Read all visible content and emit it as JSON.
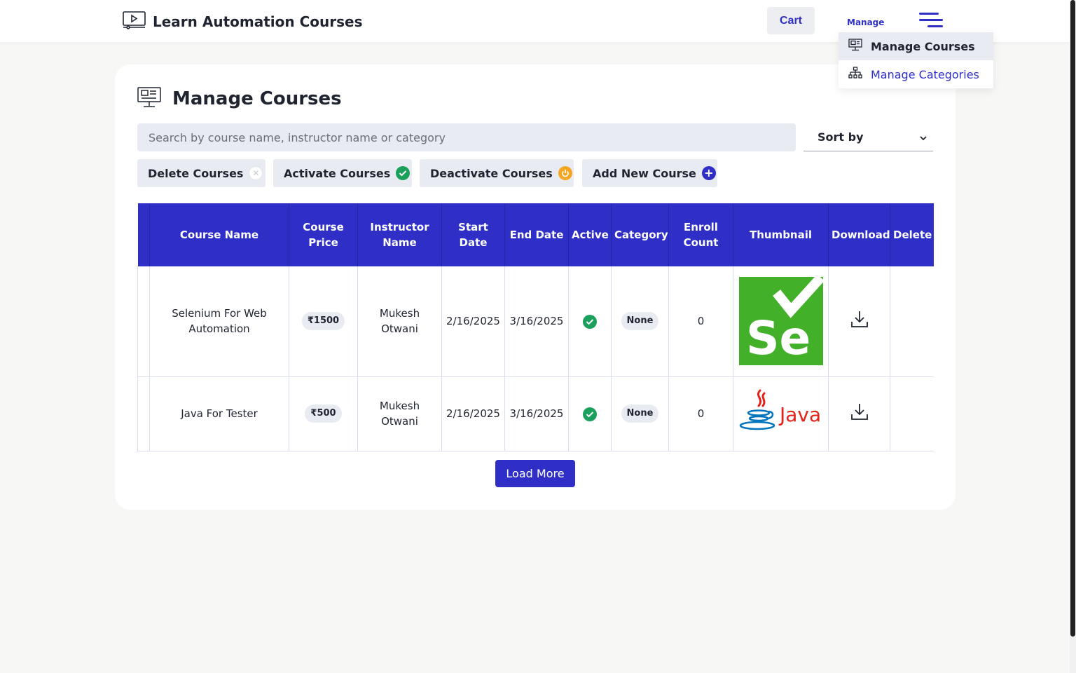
{
  "header": {
    "brand_title": "Learn Automation Courses",
    "cart_label": "Cart",
    "manage_label": "Manage"
  },
  "dropdown": {
    "items": [
      {
        "label": "Manage Courses",
        "icon": "monitor-icon",
        "active": true
      },
      {
        "label": "Manage Categories",
        "icon": "hierarchy-icon",
        "active": false
      }
    ]
  },
  "page": {
    "title": "Manage Courses"
  },
  "search": {
    "placeholder": "Search by course name, instructor name or category"
  },
  "sort": {
    "label": "Sort by"
  },
  "actions": {
    "delete": "Delete Courses",
    "activate": "Activate Courses",
    "deactivate": "Deactivate Courses",
    "add": "Add New Course"
  },
  "table": {
    "headers": {
      "course_name": "Course Name",
      "course_price_1": "Course",
      "course_price_2": "Price",
      "instructor_1": "Instructor",
      "instructor_2": "Name",
      "start_date": "Start Date",
      "end_date": "End Date",
      "active": "Active",
      "category": "Category",
      "enroll_1": "Enroll",
      "enroll_2": "Count",
      "thumbnail": "Thumbnail",
      "download": "Download",
      "delete": "Delete"
    },
    "rows": [
      {
        "course_name_1": "Selenium For Web",
        "course_name_2": "Automation",
        "price": "₹1500",
        "instructor_1": "Mukesh",
        "instructor_2": "Otwani",
        "start_date": "2/16/2025",
        "end_date": "3/16/2025",
        "category": "None",
        "enroll_count": "0",
        "thumbnail_text": "Se"
      },
      {
        "course_name_1": "Java For Tester",
        "course_name_2": "",
        "price": "₹500",
        "instructor_1": "Mukesh",
        "instructor_2": "Otwani",
        "start_date": "2/16/2025",
        "end_date": "3/16/2025",
        "category": "None",
        "enroll_count": "0",
        "thumbnail_text": "Java"
      }
    ]
  },
  "load_more": "Load More",
  "colors": {
    "accent": "#2f2fc8",
    "active_green": "#1aa05a",
    "deactivate_orange": "#f5a623",
    "selenium_green": "#43b02a",
    "java_red": "#e2231a",
    "java_blue": "#0074bd"
  }
}
